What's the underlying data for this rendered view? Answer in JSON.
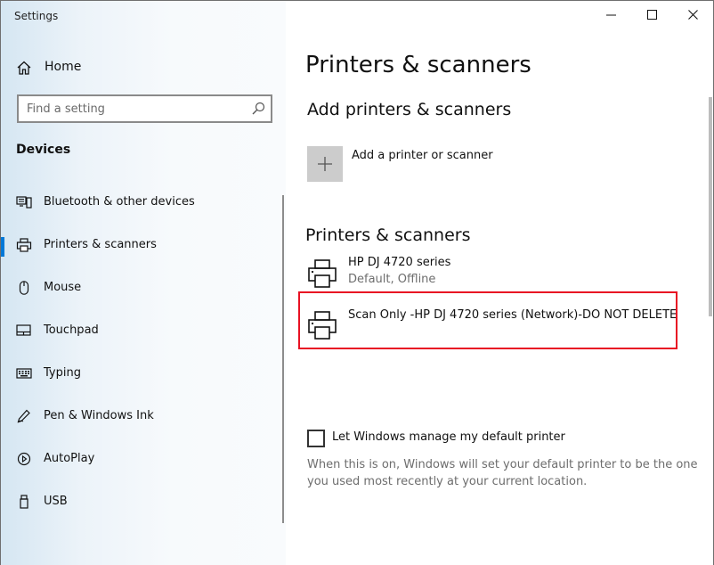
{
  "window": {
    "title": "Settings"
  },
  "sidebar": {
    "home_label": "Home",
    "search_placeholder": "Find a setting",
    "section_title": "Devices",
    "items": [
      {
        "label": "Bluetooth & other devices",
        "icon": "bluetooth-devices-icon",
        "active": false
      },
      {
        "label": "Printers & scanners",
        "icon": "printer-icon",
        "active": true
      },
      {
        "label": "Mouse",
        "icon": "mouse-icon",
        "active": false
      },
      {
        "label": "Touchpad",
        "icon": "touchpad-icon",
        "active": false
      },
      {
        "label": "Typing",
        "icon": "keyboard-icon",
        "active": false
      },
      {
        "label": "Pen & Windows Ink",
        "icon": "pen-icon",
        "active": false
      },
      {
        "label": "AutoPlay",
        "icon": "autoplay-icon",
        "active": false
      },
      {
        "label": "USB",
        "icon": "usb-icon",
        "active": false
      }
    ]
  },
  "main": {
    "page_title": "Printers & scanners",
    "add_section_title": "Add printers & scanners",
    "add_button_label": "Add a printer or scanner",
    "list_section_title": "Printers & scanners",
    "printers": [
      {
        "name": "HP DJ 4720 series",
        "status": "Default, Offline"
      },
      {
        "name": "Scan Only -HP DJ 4720 series (Network)-DO NOT DELETE",
        "status": ""
      }
    ],
    "default_printer_checkbox_label": "Let Windows manage my default printer",
    "default_printer_checked": false,
    "default_printer_help": "When this is on, Windows will set your default printer to be the one you used most recently at your current location."
  },
  "colors": {
    "accent": "#0078d7",
    "highlight_border": "#e81123",
    "add_button_bg": "#cccccc"
  }
}
